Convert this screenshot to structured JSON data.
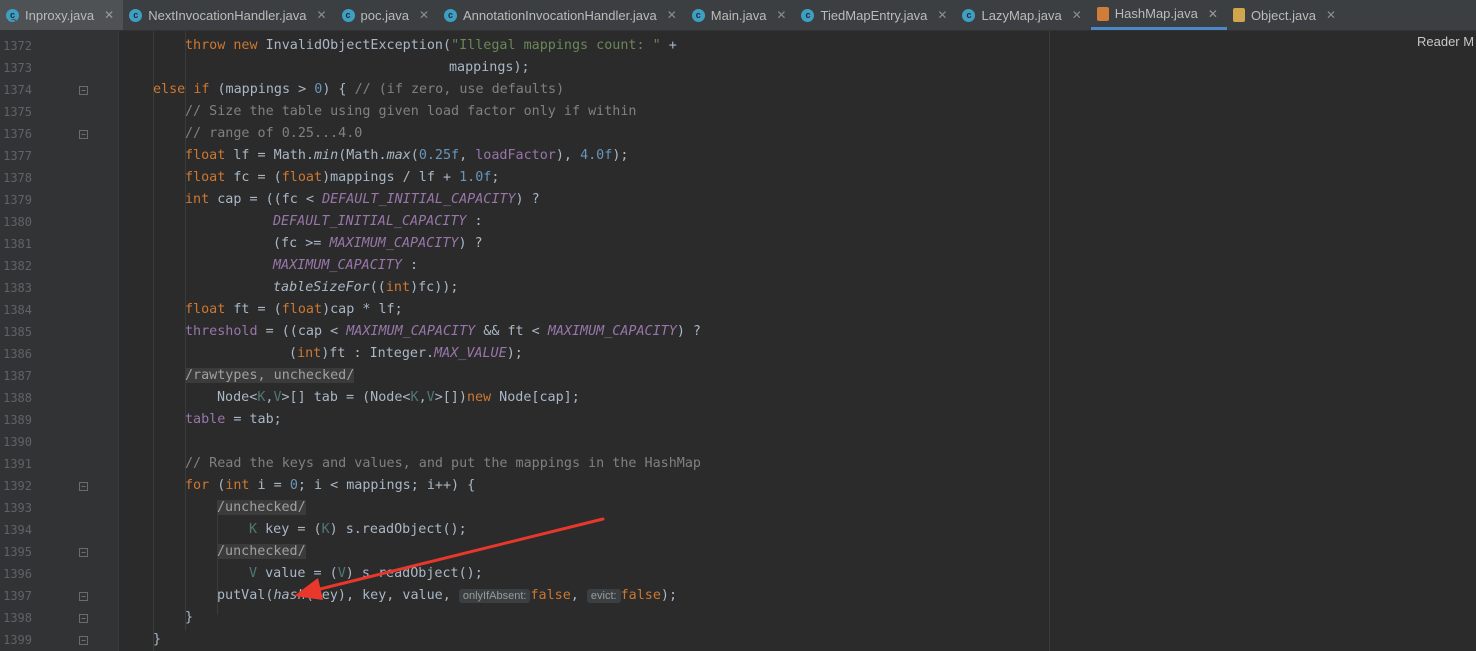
{
  "tabs": [
    {
      "label": "Inproxy.java",
      "icon": "java-class-icon"
    },
    {
      "label": "NextInvocationHandler.java",
      "icon": "java-class-icon"
    },
    {
      "label": "poc.java",
      "icon": "java-class-icon"
    },
    {
      "label": "AnnotationInvocationHandler.java",
      "icon": "java-class-icon"
    },
    {
      "label": "Main.java",
      "icon": "java-class-icon"
    },
    {
      "label": "TiedMapEntry.java",
      "icon": "java-class-icon"
    },
    {
      "label": "LazyMap.java",
      "icon": "java-class-icon"
    },
    {
      "label": "HashMap.java",
      "icon": "java-file-icon"
    },
    {
      "label": "Object.java",
      "icon": "java-file-icon"
    }
  ],
  "reader_mode_label": "Reader M",
  "line_numbers": [
    "1372",
    "1373",
    "1374",
    "1375",
    "1376",
    "1377",
    "1378",
    "1379",
    "1380",
    "1381",
    "1382",
    "1383",
    "1384",
    "1385",
    "1386",
    "1387",
    "1388",
    "1389",
    "1390",
    "1391",
    "1392",
    "1393",
    "1394",
    "1395",
    "1396",
    "1397",
    "1398",
    "1399"
  ],
  "code": {
    "l1372_kw1": "throw",
    "l1372_kw2": "new",
    "l1372_cls": "InvalidObjectException(",
    "l1372_str": "\"Illegal mappings count: \"",
    "l1372_op": " +",
    "l1373": "mappings);",
    "l1374_kw1": "else",
    "l1374_kw2": "if",
    "l1374_a": " (mappings > ",
    "l1374_num": "0",
    "l1374_b": ") { ",
    "l1374_cmt": "// (if zero, use defaults)",
    "l1375": "// Size the table using given load factor only if within",
    "l1376": "// range of 0.25...4.0",
    "l1377_kw": "float",
    "l1377_a": " lf = Math.",
    "l1377_min": "min",
    "l1377_b": "(Math.",
    "l1377_max": "max",
    "l1377_c": "(",
    "l1377_n1": "0.25f",
    "l1377_d": ", ",
    "l1377_fld": "loadFactor",
    "l1377_e": "), ",
    "l1377_n2": "4.0f",
    "l1377_f": ");",
    "l1378_kw": "float",
    "l1378_a": " fc = (",
    "l1378_kw2": "float",
    "l1378_b": ")mappings / lf + ",
    "l1378_num": "1.0f",
    "l1378_c": ";",
    "l1379_kw": "int",
    "l1379_a": " cap = ((fc < ",
    "l1379_cst": "DEFAULT_INITIAL_CAPACITY",
    "l1379_b": ") ?",
    "l1380_cst": "DEFAULT_INITIAL_CAPACITY",
    "l1380_b": " :",
    "l1381_a": "(fc >= ",
    "l1381_cst": "MAXIMUM_CAPACITY",
    "l1381_b": ") ?",
    "l1382_cst": "MAXIMUM_CAPACITY",
    "l1382_b": " :",
    "l1383_mth": "tableSizeFor",
    "l1383_a": "((",
    "l1383_kw": "int",
    "l1383_b": ")fc));",
    "l1384_kw": "float",
    "l1384_a": " ft = (",
    "l1384_kw2": "float",
    "l1384_b": ")cap * lf;",
    "l1385_fld": "threshold",
    "l1385_a": " = ((cap < ",
    "l1385_cst1": "MAXIMUM_CAPACITY",
    "l1385_b": " && ft < ",
    "l1385_cst2": "MAXIMUM_CAPACITY",
    "l1385_c": ") ?",
    "l1386_a": "(",
    "l1386_kw": "int",
    "l1386_b": ")ft : Integer.",
    "l1386_cst": "MAX_VALUE",
    "l1386_c": ");",
    "l1387": "/rawtypes, unchecked/",
    "l1388_a": "Node<",
    "l1388_g1": "K",
    "l1388_b": ",",
    "l1388_g2": "V",
    "l1388_c": ">[] tab = (Node<",
    "l1388_g3": "K",
    "l1388_d": ",",
    "l1388_g4": "V",
    "l1388_e": ">[])",
    "l1388_kw": "new",
    "l1388_f": " Node[cap];",
    "l1389_fld": "table",
    "l1389_a": " = tab;",
    "l1391": "// Read the keys and values, and put the mappings in the HashMap",
    "l1392_kw": "for",
    "l1392_a": " (",
    "l1392_kw2": "int",
    "l1392_b": " i = ",
    "l1392_num": "0",
    "l1392_c": "; i < mappings; i++) {",
    "l1393": "/unchecked/",
    "l1394_g": "K",
    "l1394_a": " key = (",
    "l1394_g2": "K",
    "l1394_b": ") s.readObject();",
    "l1395": "/unchecked/",
    "l1396_g": "V",
    "l1396_a": " value = (",
    "l1396_g2": "V",
    "l1396_b": ") s.readObject();",
    "l1397_a": "putVal(",
    "l1397_mth": "hash",
    "l1397_b": "(key), key, value, ",
    "l1397_hint1": "onlyIfAbsent:",
    "l1397_kw1": "false",
    "l1397_c": ", ",
    "l1397_hint2": "evict:",
    "l1397_kw2": "false",
    "l1397_d": ");",
    "l1398": "}",
    "l1399": "}"
  },
  "colors": {
    "keyword": "#cc7832",
    "number": "#6897bb",
    "string": "#6a8759",
    "comment": "#808080",
    "field": "#9876aa",
    "generic": "#507874",
    "arrow": "#e8372b"
  }
}
